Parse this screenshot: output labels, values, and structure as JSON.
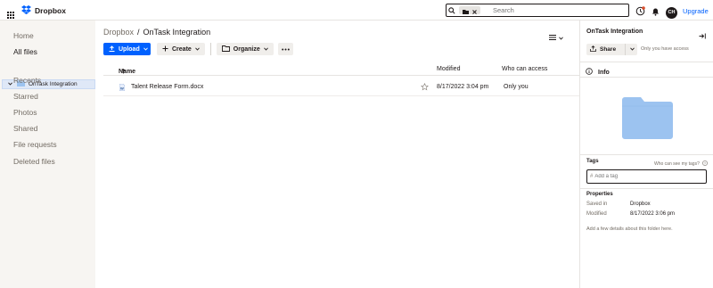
{
  "app": {
    "brand": "Dropbox",
    "upgrade_label": "Upgrade",
    "avatar_initials": "CH"
  },
  "search": {
    "placeholder": "Search"
  },
  "sidebar": {
    "items": [
      {
        "label": "Home"
      },
      {
        "label": "All files"
      },
      {
        "label": "Recents"
      },
      {
        "label": "Starred"
      },
      {
        "label": "Photos"
      },
      {
        "label": "Shared"
      },
      {
        "label": "File requests"
      },
      {
        "label": "Deleted files"
      }
    ],
    "subfolder": "OnTask Integration"
  },
  "breadcrumb": {
    "root": "Dropbox",
    "separator": "/",
    "current": "OnTask Integration"
  },
  "toolbar": {
    "upload": "Upload",
    "create": "Create",
    "organize": "Organize"
  },
  "table": {
    "headers": {
      "name": "Name",
      "modified": "Modified",
      "access": "Who can access"
    },
    "rows": [
      {
        "name": "Talent Release Form.docx",
        "modified": "8/17/2022 3:04 pm",
        "access": "Only you"
      }
    ]
  },
  "details": {
    "title": "OnTask Integration",
    "share_label": "Share",
    "access_text": "Only you have access",
    "info_label": "Info",
    "tags_title": "Tags",
    "tags_help": "Who can see my tags?",
    "tag_placeholder": "Add a tag",
    "properties_title": "Properties",
    "props": [
      {
        "label": "Saved in",
        "value": "Dropbox"
      },
      {
        "label": "Modified",
        "value": "8/17/2022 3:06 pm"
      }
    ],
    "note": "Add a few details about this folder here."
  },
  "colors": {
    "accent": "#0061fe",
    "folder": "#9cc3f0",
    "sidebar_bg": "#f7f5f2"
  }
}
